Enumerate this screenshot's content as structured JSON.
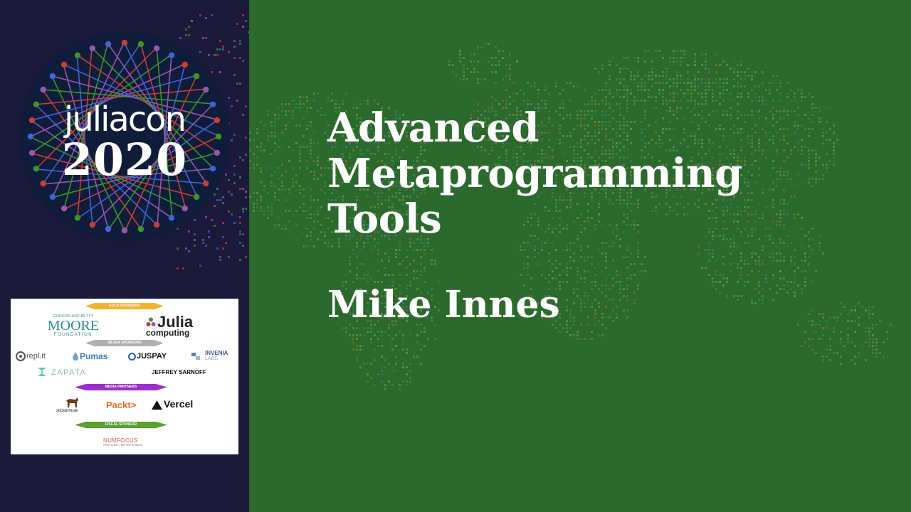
{
  "conference": {
    "logo_word": "juliacon",
    "logo_year": "2020"
  },
  "talk": {
    "title_lines": [
      "Advanced",
      "Metaprogramming",
      "Tools"
    ],
    "speaker": "Mike Innes"
  },
  "sponsors": {
    "gold_banner": "GOLD SPONSORS",
    "silver_banner": "SILVER SPONSORS",
    "media_banner": "MEDIA PARTNERS",
    "fiscal_banner": "FISCAL SPONSOR",
    "moore_top": "GORDON AND BETTY",
    "moore_name": "MOORE",
    "moore_bottom": "FOUNDATION",
    "julia_name": "Julia",
    "julia_sub": "computing",
    "replit": "repl.it",
    "pumas": "Pumas",
    "juspay": "JUSPAY",
    "invenia": "INVENIA",
    "invenia_sub": "LABS",
    "zapata": "ZAPATA",
    "sarnoff": "JEFFREY SARNOFF",
    "stickermule": "stickermule",
    "packt": "Packt>",
    "vercel": "Vercel",
    "numfocus": "NUMFOCUS",
    "numfocus_sub": "OPEN CODE = BETTER SCIENCE"
  },
  "colors": {
    "left_bg": "#1b1a3a",
    "main_bg": "#2b6a2c",
    "julia_red": "#cb3c33",
    "julia_green": "#389826",
    "julia_purple": "#9558b2",
    "julia_blue": "#4063d8",
    "gold_banner": "#f2b233",
    "silver_banner": "#b0b0b0",
    "media_banner": "#9b30c8",
    "fiscal_banner": "#5aa02c"
  }
}
